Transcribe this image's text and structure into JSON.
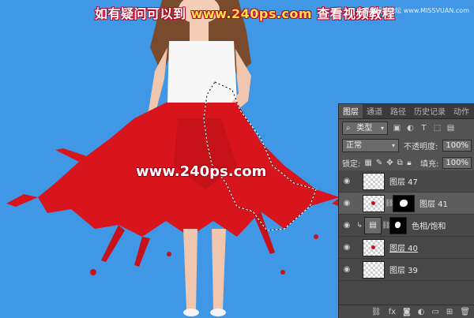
{
  "banner": {
    "text_before": "如有疑问可以到",
    "site": "www.240ps.com",
    "text_after": "查看视频教程"
  },
  "corner": "思缘设计论坛 www.MISSVUAN.com",
  "watermark": "www.240ps.com",
  "colors": {
    "background": "#3f97e6",
    "skirt_red": "#d8141c",
    "panel_bg": "#535353"
  },
  "layers_panel": {
    "tabs": [
      "图层",
      "通道",
      "路径",
      "历史记录",
      "动作"
    ],
    "active_tab": "图层",
    "filter_kind": "类型",
    "blend_mode": "正常",
    "opacity_label": "不透明度:",
    "opacity_value": "100%",
    "lock_label": "锁定:",
    "fill_label": "填充:",
    "fill_value": "100%",
    "layers": [
      {
        "name": "图层 47",
        "icon": "eye-icon",
        "selected": false
      },
      {
        "name": "图层 41",
        "icon": "eye-icon",
        "selected": true,
        "has_mask": true
      },
      {
        "name": "色相/饱和",
        "icon": "eye-icon",
        "selected": false,
        "adjustment": true
      },
      {
        "name": "图层 40",
        "icon": "eye-icon",
        "selected": false
      },
      {
        "name": "图层 39",
        "icon": "eye-icon",
        "selected": false
      }
    ],
    "bottom_icons": [
      "link-icon",
      "fx-icon",
      "add-mask-icon",
      "adjustment-icon",
      "group-icon",
      "new-layer-icon",
      "trash-icon"
    ]
  }
}
